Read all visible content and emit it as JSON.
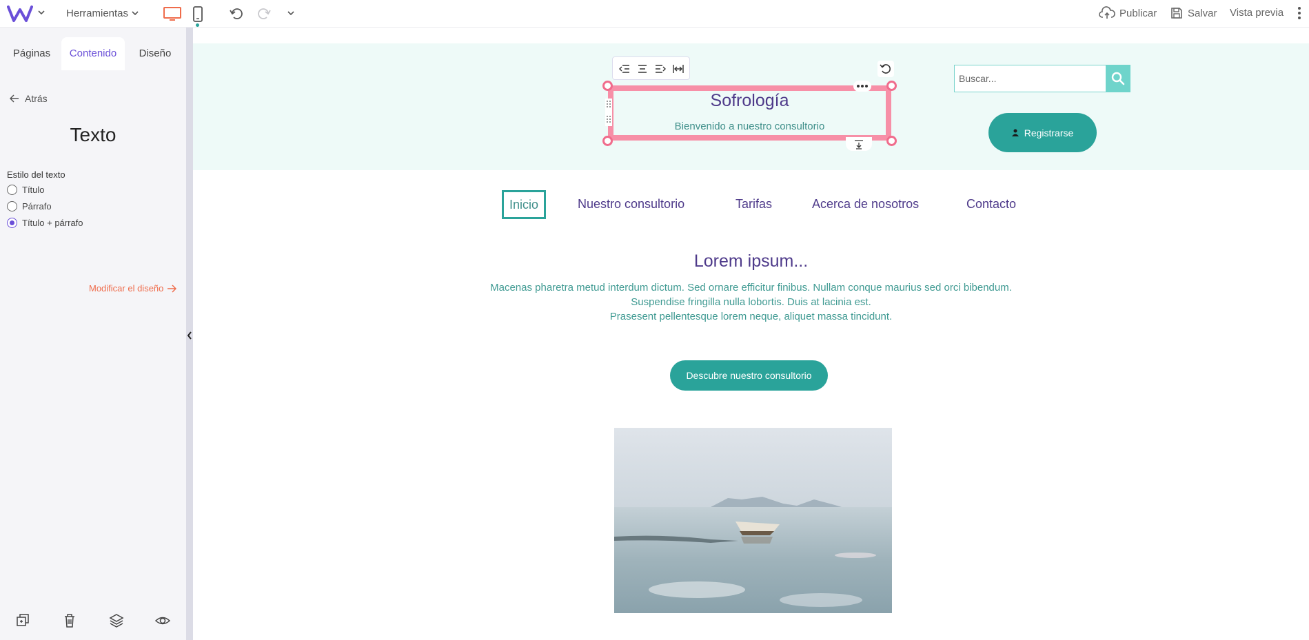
{
  "topbar": {
    "tools_label": "Herramientas",
    "publish_label": "Publicar",
    "save_label": "Salvar",
    "preview_label": "Vista previa",
    "accent_color": "#6a4fd8",
    "device_color": "#ef6c4b"
  },
  "sidebar": {
    "tabs": [
      {
        "label": "Páginas"
      },
      {
        "label": "Contenido",
        "active": true
      },
      {
        "label": "Diseño"
      }
    ],
    "back_label": "Atrás",
    "title": "Texto",
    "style_label": "Estilo del texto",
    "options": [
      {
        "label": "Título",
        "checked": false
      },
      {
        "label": "Párrafo",
        "checked": false
      },
      {
        "label": "Título + párrafo",
        "checked": true
      }
    ],
    "modify_label": "Modificar el diseño",
    "bottom_icons": [
      "duplicate-icon",
      "trash-icon",
      "layers-icon",
      "eye-icon"
    ]
  },
  "site": {
    "title": "Sofrología",
    "subtitle": "Bienvenido a nuestro consultorio",
    "search_placeholder": "Buscar...",
    "register_label": "Registrarse",
    "nav": [
      "Inicio",
      "Nuestro consultorio",
      "Tarifas",
      "Acerca de nosotros",
      "Contacto"
    ],
    "nav_active": "Inicio",
    "section_title": "Lorem ipsum...",
    "section_lines": [
      "Macenas pharetra metud interdum dictum. Sed ornare efficitur finibus. Nullam conque maurius sed orci bibendum.",
      "Suspendise fringilla nulla lobortis. Duis at lacinia est.",
      "Prasesent pellentesque lorem neque, aliquet massa tincidunt."
    ],
    "cta_label": "Descubre nuestro consultorio",
    "brand_color": "#2aa39a",
    "title_color": "#4e3a8a",
    "selection_color": "#f78fa7"
  }
}
